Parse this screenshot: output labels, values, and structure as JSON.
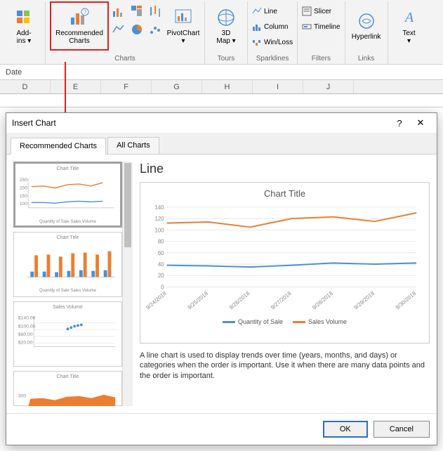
{
  "ribbon": {
    "groups": {
      "addins": {
        "label": "",
        "btn": "Add-\nins ▾"
      },
      "charts": {
        "label": "Charts",
        "recommended": "Recommended\nCharts",
        "pivot": "PivotChart\n▾"
      },
      "tours": {
        "label": "Tours",
        "map": "3D\nMap ▾"
      },
      "sparklines": {
        "label": "Sparklines",
        "line": "Line",
        "column": "Column",
        "winloss": "Win/Loss"
      },
      "filters": {
        "label": "Filters",
        "slicer": "Slicer",
        "timeline": "Timeline"
      },
      "links": {
        "label": "Links",
        "hyperlink": "Hyperlink"
      },
      "text": {
        "btn": "Text\n▾"
      }
    }
  },
  "formula": "Date",
  "columns": [
    "D",
    "E",
    "F",
    "G",
    "H",
    "I",
    "J"
  ],
  "dialog": {
    "title": "Insert Chart",
    "tabs": {
      "rec": "Recommended Charts",
      "all": "All Charts"
    },
    "thumbs": {
      "t1": "Chart Title",
      "t1l": "Quantity of Sale    Sales Volume",
      "t2": "Chart Title",
      "t2l": "Quantity of Sale    Sales Volume",
      "t3": "Sales Volume",
      "t4": "Chart Title"
    },
    "preview": {
      "heading": "Line",
      "title": "Chart Title",
      "legend": {
        "a": "Quantity of Sale",
        "b": "Sales Volume"
      },
      "desc": "A line chart is used to display trends over time (years, months, and days) or categories when the order is important. Use it when there are many data points and the order is important."
    },
    "ok": "OK",
    "cancel": "Cancel"
  },
  "chart_data": {
    "type": "line",
    "title": "Chart Title",
    "categories": [
      "9/24/2018",
      "9/25/2018",
      "9/26/2018",
      "9/27/2018",
      "9/28/2018",
      "9/29/2018",
      "9/30/2018"
    ],
    "series": [
      {
        "name": "Quantity of Sale",
        "values": [
          38,
          37,
          35,
          38,
          42,
          40,
          42
        ],
        "color": "#4a90d9"
      },
      {
        "name": "Sales Volume",
        "values": [
          112,
          114,
          105,
          120,
          123,
          115,
          130
        ],
        "color": "#ed7d31"
      }
    ],
    "ylabel": "",
    "xlabel": "",
    "ylim": [
      0,
      140
    ],
    "yticks": [
      0,
      20,
      40,
      60,
      80,
      100,
      120,
      140
    ]
  }
}
